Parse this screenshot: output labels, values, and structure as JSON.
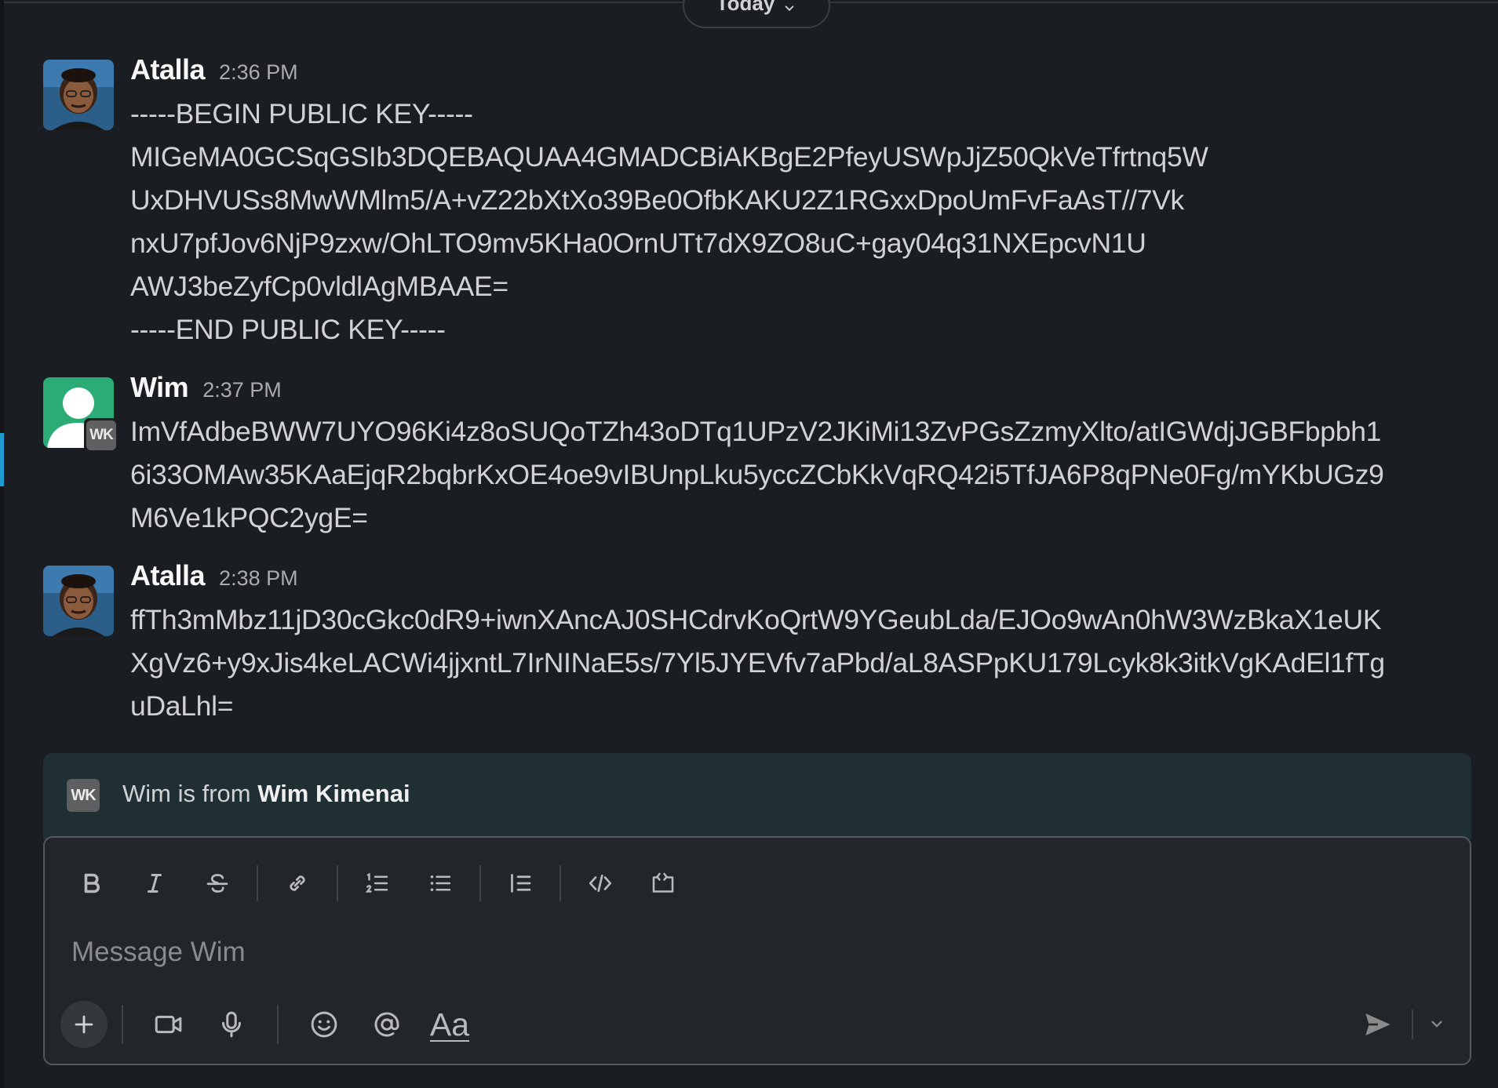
{
  "date_divider": {
    "label": "Today"
  },
  "messages": [
    {
      "sender": "Atalla",
      "time": "2:36 PM",
      "lines": [
        "-----BEGIN PUBLIC KEY-----",
        "MIGeMA0GCSqGSIb3DQEBAQUAA4GMADCBiAKBgE2PfeyUSWpJjZ50QkVeTfrtnq5W",
        "UxDHVUSs8MwWMlm5/A+vZ22bXtXo39Be0OfbKAKU2Z1RGxxDpoUmFvFaAsT//7Vk",
        "nxU7pfJov6NjP9zxw/OhLTO9mv5KHa0OrnUTt7dX9ZO8uC+gay04q31NXEpcvN1U",
        "AWJ3beZyfCp0vldlAgMBAAE=",
        "-----END PUBLIC KEY-----"
      ]
    },
    {
      "sender": "Wim",
      "time": "2:37 PM",
      "badge": "WK",
      "lines": [
        "ImVfAdbeBWW7UYO96Ki4z8oSUQoTZh43oDTq1UPzV2JKiMi13ZvPGsZzmyXlto/atIGWdjJGBFbpbh1",
        "6i33OMAw35KAaEjqR2bqbrKxOE4oe9vIBUnpLku5yccZCbKkVqRQ42i5TfJA6P8qPNe0Fg/mYKbUGz9",
        "M6Ve1kPQC2ygE="
      ]
    },
    {
      "sender": "Atalla",
      "time": "2:38 PM",
      "lines": [
        "ffTh3mMbz11jD30cGkc0dR9+iwnXAncAJ0SHCdrvKoQrtW9YGeubLda/EJOo9wAn0hW3WzBkaX1eUK",
        "XgVz6+y9xJis4keLACWi4jjxntL7IrNINaE5s/7Yl5JYEVfv7aPbd/aL8ASPpKU179Lcyk8k3itkVgKAdEl1fTg",
        "uDaLhl="
      ]
    }
  ],
  "info_banner": {
    "badge": "WK",
    "prefix": "Wim is from ",
    "org": "Wim Kimenai"
  },
  "composer": {
    "placeholder": "Message Wim",
    "format_button": "Aa",
    "toolbar_icons": [
      "bold-icon",
      "italic-icon",
      "strikethrough-icon",
      "link-icon",
      "ordered-list-icon",
      "bulleted-list-icon",
      "blockquote-icon",
      "code-icon",
      "code-block-icon"
    ],
    "bottom_icons": [
      "plus-icon",
      "video-icon",
      "microphone-icon",
      "emoji-icon",
      "mention-icon",
      "send-icon",
      "chevron-down-icon"
    ]
  },
  "colors": {
    "background": "#1a1d21",
    "banner": "#1f2f33",
    "composer": "#222529",
    "wim_avatar": "#2bac76",
    "accent": "#1d9bd1"
  }
}
